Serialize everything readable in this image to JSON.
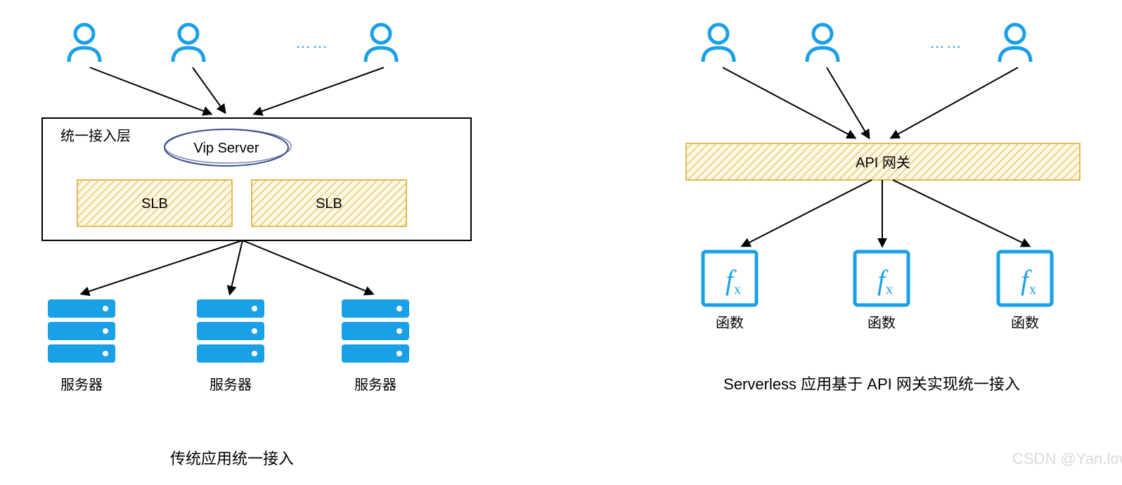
{
  "colors": {
    "blue": "#1aa0e6",
    "navy": "#3a4f8a",
    "hatch": "#e8c96b",
    "hatchFill": "#fdf7e6",
    "text": "#222",
    "watermark": "#d9d9d9"
  },
  "left": {
    "ellipsis": "……",
    "layerLabel": "统一接入层",
    "vipServer": "Vip Server",
    "slb1": "SLB",
    "slb2": "SLB",
    "server": "服务器",
    "caption": "传统应用统一接入"
  },
  "right": {
    "ellipsis": "……",
    "gateway": "API 网关",
    "func": "函数",
    "caption": "Serverless 应用基于 API 网关实现统一接入"
  },
  "watermark": "CSDN @Yan.love"
}
